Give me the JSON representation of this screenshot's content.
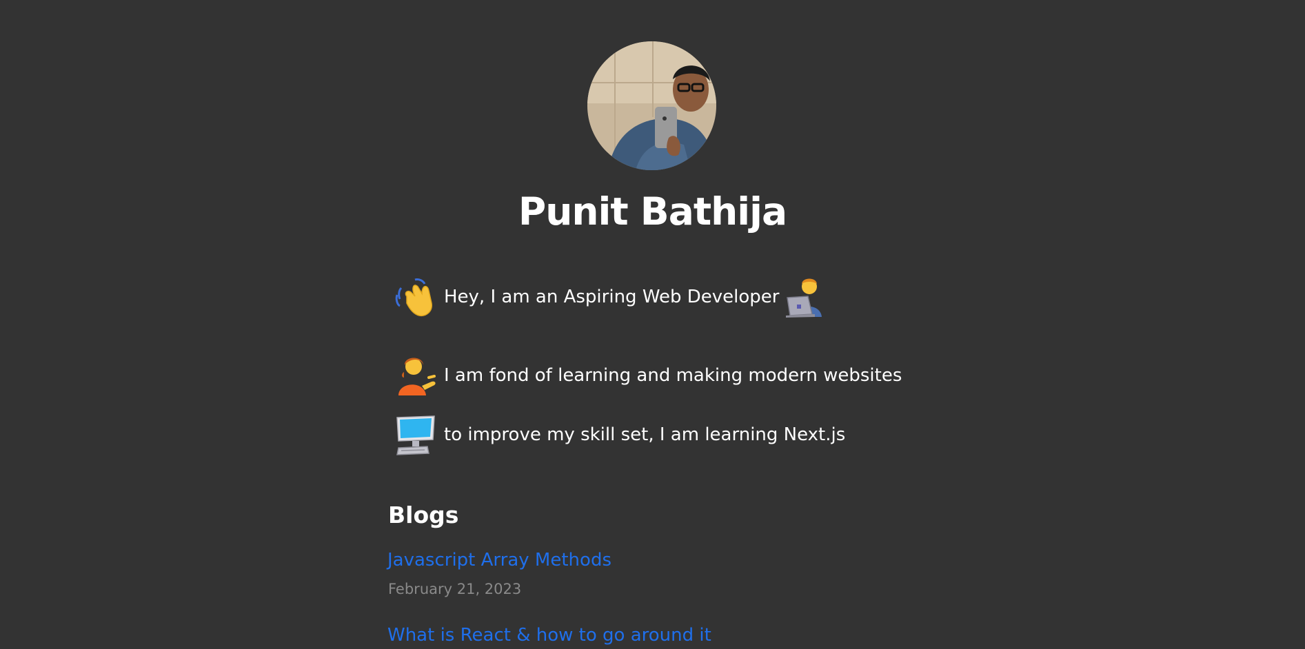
{
  "profile": {
    "name": "Punit Bathija"
  },
  "intro": [
    {
      "text": "Hey, I am an Aspiring Web Developer",
      "emoji": "waving-hand-icon",
      "trailing_emoji": "technologist-laptop-icon"
    },
    {
      "text": "I am fond of learning and making modern websites",
      "emoji": "person-tipping-hand-icon"
    },
    {
      "text": "to improve my skill set, I am learning Next.js",
      "emoji": "desktop-computer-icon"
    }
  ],
  "blogs": {
    "title": "Blogs",
    "posts": [
      {
        "title": "Javascript Array Methods",
        "date": "February 21, 2023"
      },
      {
        "title": "What is React & how to go around it"
      }
    ]
  },
  "colors": {
    "background": "#333333",
    "text": "#ffffff",
    "link": "#1f6feb",
    "muted": "#8a8a8a"
  }
}
